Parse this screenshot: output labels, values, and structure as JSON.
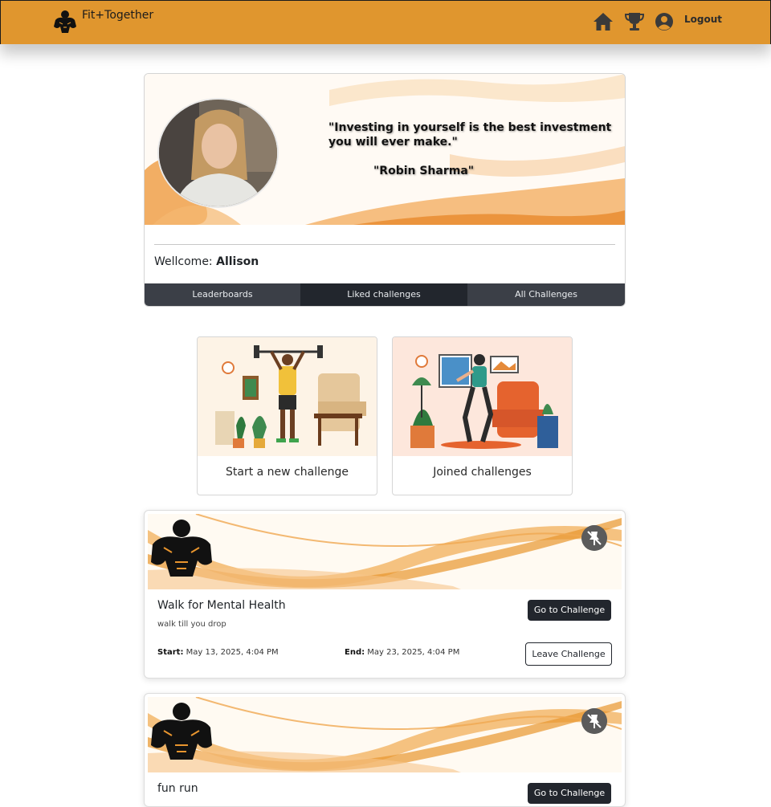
{
  "header": {
    "brand": "Fit+Together",
    "logout_label": "Logout",
    "icons": [
      "home-icon",
      "trophy-icon",
      "user-circle-icon"
    ],
    "bg_color": "#e0962e"
  },
  "profile": {
    "quote": "\"Investing in yourself is the best investment you will ever make.\"",
    "author": "\"Robin Sharma\"",
    "welcome_label": "Wellcome:",
    "user_name": "Allison"
  },
  "tabs": [
    {
      "label": "Leaderboards"
    },
    {
      "label": "Liked challenges"
    },
    {
      "label": "All Challenges"
    }
  ],
  "actions": [
    {
      "label": "Start a new challenge"
    },
    {
      "label": "Joined challenges"
    }
  ],
  "challenges": [
    {
      "title": "Walk for Mental Health",
      "description": "walk till you drop",
      "start_label": "Start:",
      "start": "May 13, 2025, 4:04 PM",
      "end_label": "End:",
      "end": "May 23, 2025, 4:04 PM",
      "primary_button": "Go to Challenge",
      "secondary_button": "Leave Challenge"
    },
    {
      "title": "fun run",
      "primary_button": "Go to Challenge"
    }
  ]
}
